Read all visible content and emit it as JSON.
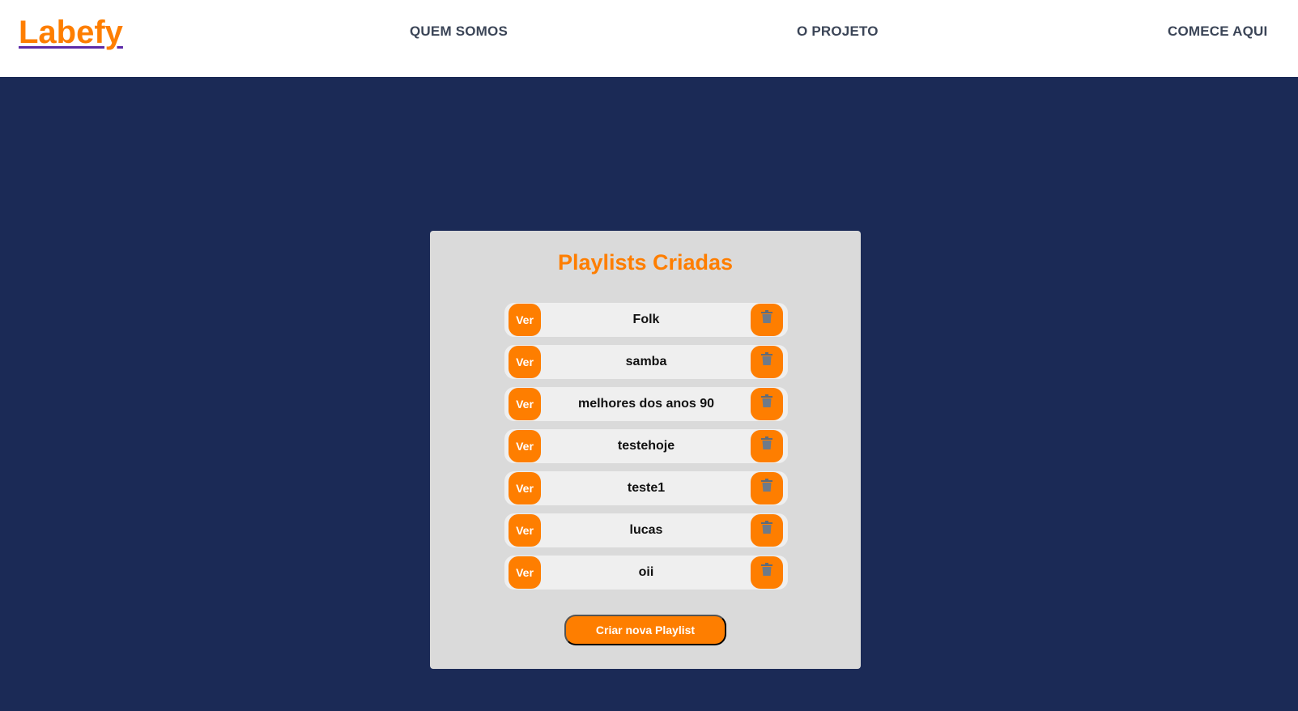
{
  "header": {
    "logo": "Labefy",
    "nav": [
      "QUEM SOMOS",
      "O PROJETO",
      "COMECE AQUI"
    ]
  },
  "card": {
    "title": "Playlists Criadas",
    "view_label": "Ver",
    "delete_icon": "trash-icon",
    "playlists": [
      "Folk",
      "samba",
      "melhores dos anos 90",
      "testehoje",
      "teste1",
      "lucas",
      "oii"
    ],
    "create_label": "Criar nova Playlist"
  },
  "colors": {
    "background": "#1b2a56",
    "header": "#ffffff",
    "accent": "#fe7e00",
    "logo_underline": "#5c2aa8",
    "card": "#dadada",
    "row": "#efefef",
    "nav_text": "#3b4557"
  }
}
